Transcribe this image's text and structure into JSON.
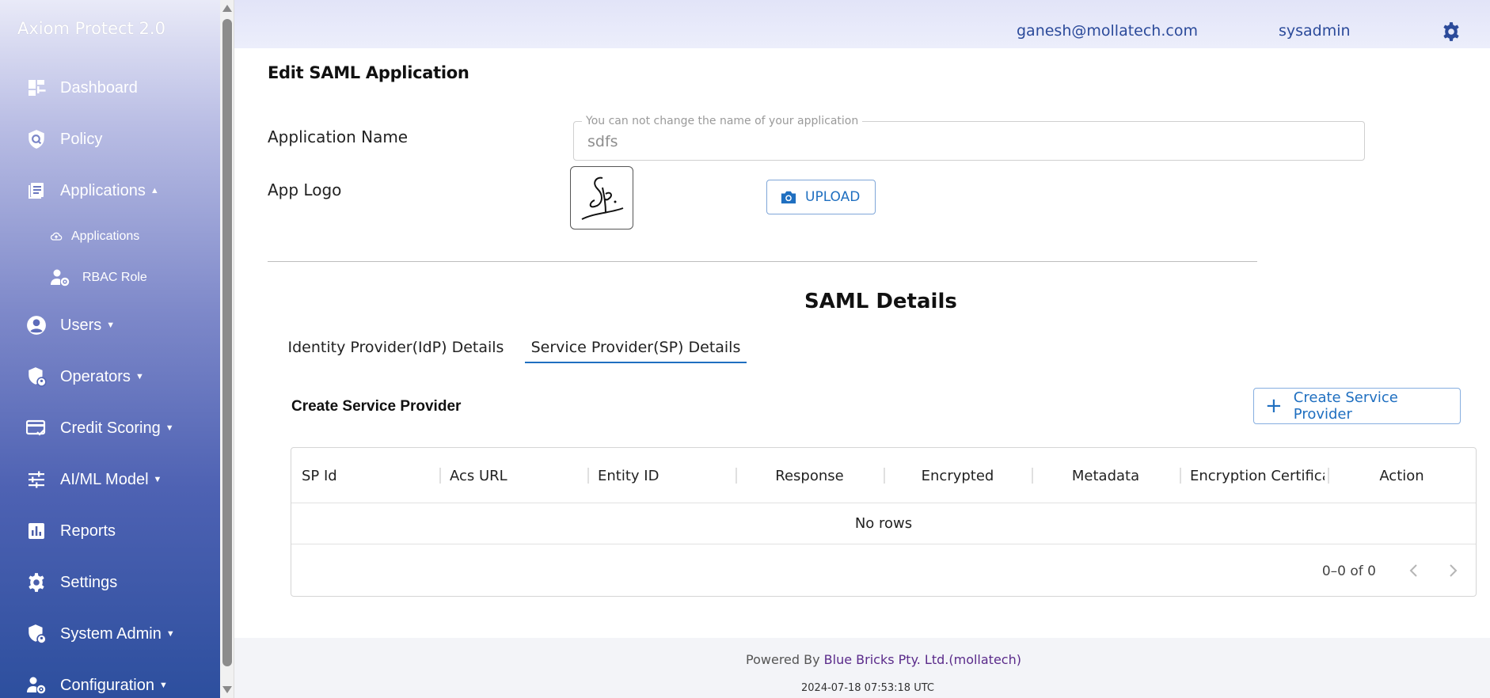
{
  "sidebar": {
    "brand": "Axiom Protect 2.0",
    "items": [
      {
        "label": "Dashboard",
        "icon": "dashboard-icon"
      },
      {
        "label": "Policy",
        "icon": "policy-shield-icon"
      },
      {
        "label": "Applications",
        "icon": "applications-icon",
        "expanded": true
      },
      {
        "label": "Users",
        "icon": "user-circle-icon"
      },
      {
        "label": "Operators",
        "icon": "operators-shield-icon"
      },
      {
        "label": "Credit Scoring",
        "icon": "credit-card-icon"
      },
      {
        "label": "AI/ML Model",
        "icon": "sliders-icon"
      },
      {
        "label": "Reports",
        "icon": "bar-chart-icon"
      },
      {
        "label": "Settings",
        "icon": "gear-icon"
      },
      {
        "label": "System Admin",
        "icon": "admin-shield-icon"
      },
      {
        "label": "Configuration",
        "icon": "user-gear-icon"
      }
    ],
    "subitems": [
      {
        "label": "Applications",
        "icon": "cloud-upload-icon"
      },
      {
        "label": "RBAC Role",
        "icon": "user-gear-icon"
      }
    ]
  },
  "header": {
    "email": "ganesh@mollatech.com",
    "user": "sysadmin"
  },
  "main": {
    "title": "Edit SAML Application",
    "app_name_label": "Application Name",
    "app_name_legend": "You can not change the name of your application",
    "app_name_value": "sdfs",
    "app_logo_label": "App Logo",
    "upload_label": "UPLOAD",
    "section_title": "SAML Details",
    "tabs": [
      {
        "label": "Identity Provider(IdP) Details",
        "active": false
      },
      {
        "label": "Service Provider(SP) Details",
        "active": true
      }
    ],
    "create_title": "Create Service Provider",
    "create_button": "Create Service Provider",
    "table": {
      "columns": [
        "SP Id",
        "Acs URL",
        "Entity ID",
        "Response",
        "Encrypted",
        "Metadata",
        "Encryption Certifica…",
        "Action"
      ],
      "empty_text": "No rows",
      "pagination": "0–0 of 0"
    }
  },
  "footer": {
    "powered_prefix": "Powered By",
    "powered_brand": "Blue Bricks Pty. Ltd.(mollatech)",
    "timestamp": "2024-07-18 07:53:18 UTC"
  },
  "colors": {
    "accent": "#1f6fc0",
    "header_text": "#2b4a9a",
    "sidebar_bottom": "#2d4f9e"
  }
}
